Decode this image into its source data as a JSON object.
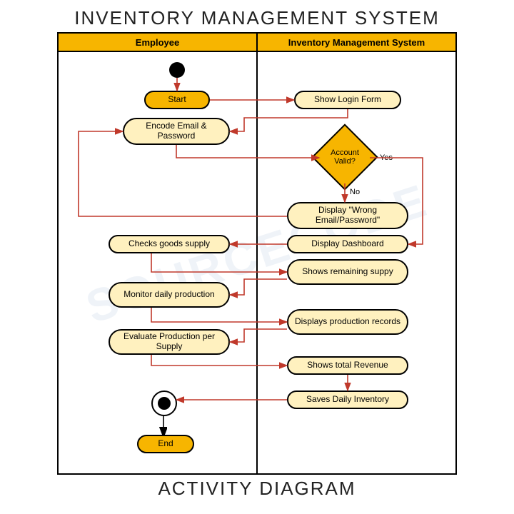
{
  "titles": {
    "top": "INVENTORY MANAGEMENT SYSTEM",
    "bottom": "ACTIVITY DIAGRAM"
  },
  "lanes": {
    "left": "Employee",
    "right": "Inventory Management System"
  },
  "nodes": {
    "start": "Start",
    "show_login": "Show Login Form",
    "encode": "Encode Email & Password",
    "decision": "Account Valid?",
    "wrong": "Display \"Wrong Email/Password\"",
    "dashboard": "Display Dashboard",
    "checks_goods": "Checks goods supply",
    "remaining": "Shows remaining suppy",
    "monitor": "Monitor daily production",
    "prod_records": "Displays production records",
    "evaluate": "Evaluate Production per Supply",
    "revenue": "Shows total Revenue",
    "saves": "Saves Daily Inventory",
    "end": "End"
  },
  "labels": {
    "yes": "Yes",
    "no": "No"
  },
  "watermark": "SOURCECODE",
  "chart_data": {
    "type": "activity-diagram",
    "title": "Inventory Management System – Activity Diagram",
    "swimlanes": [
      "Employee",
      "Inventory Management System"
    ],
    "activities": [
      {
        "id": "initial",
        "lane": "Employee",
        "kind": "initial"
      },
      {
        "id": "start",
        "lane": "Employee",
        "kind": "action",
        "label": "Start"
      },
      {
        "id": "show_login",
        "lane": "Inventory Management System",
        "kind": "action",
        "label": "Show Login Form"
      },
      {
        "id": "encode",
        "lane": "Employee",
        "kind": "action",
        "label": "Encode Email & Password"
      },
      {
        "id": "decision",
        "lane": "Inventory Management System",
        "kind": "decision",
        "label": "Account Valid?"
      },
      {
        "id": "wrong",
        "lane": "Inventory Management System",
        "kind": "action",
        "label": "Display \"Wrong Email/Password\""
      },
      {
        "id": "dashboard",
        "lane": "Inventory Management System",
        "kind": "action",
        "label": "Display Dashboard"
      },
      {
        "id": "checks_goods",
        "lane": "Employee",
        "kind": "action",
        "label": "Checks goods supply"
      },
      {
        "id": "remaining",
        "lane": "Inventory Management System",
        "kind": "action",
        "label": "Shows remaining suppy"
      },
      {
        "id": "monitor",
        "lane": "Employee",
        "kind": "action",
        "label": "Monitor daily production"
      },
      {
        "id": "prod_records",
        "lane": "Inventory Management System",
        "kind": "action",
        "label": "Displays production records"
      },
      {
        "id": "evaluate",
        "lane": "Employee",
        "kind": "action",
        "label": "Evaluate Production per Supply"
      },
      {
        "id": "revenue",
        "lane": "Inventory Management System",
        "kind": "action",
        "label": "Shows total Revenue"
      },
      {
        "id": "saves",
        "lane": "Inventory Management System",
        "kind": "action",
        "label": "Saves Daily Inventory"
      },
      {
        "id": "final",
        "lane": "Employee",
        "kind": "final"
      },
      {
        "id": "end",
        "lane": "Employee",
        "kind": "action",
        "label": "End"
      }
    ],
    "transitions": [
      {
        "from": "initial",
        "to": "start"
      },
      {
        "from": "start",
        "to": "show_login"
      },
      {
        "from": "show_login",
        "to": "encode"
      },
      {
        "from": "encode",
        "to": "decision"
      },
      {
        "from": "decision",
        "to": "wrong",
        "guard": "No"
      },
      {
        "from": "decision",
        "to": "dashboard",
        "guard": "Yes"
      },
      {
        "from": "wrong",
        "to": "encode"
      },
      {
        "from": "dashboard",
        "to": "checks_goods"
      },
      {
        "from": "checks_goods",
        "to": "remaining"
      },
      {
        "from": "remaining",
        "to": "monitor"
      },
      {
        "from": "monitor",
        "to": "prod_records"
      },
      {
        "from": "prod_records",
        "to": "evaluate"
      },
      {
        "from": "evaluate",
        "to": "revenue"
      },
      {
        "from": "revenue",
        "to": "saves"
      },
      {
        "from": "saves",
        "to": "final"
      },
      {
        "from": "final",
        "to": "end"
      }
    ]
  }
}
